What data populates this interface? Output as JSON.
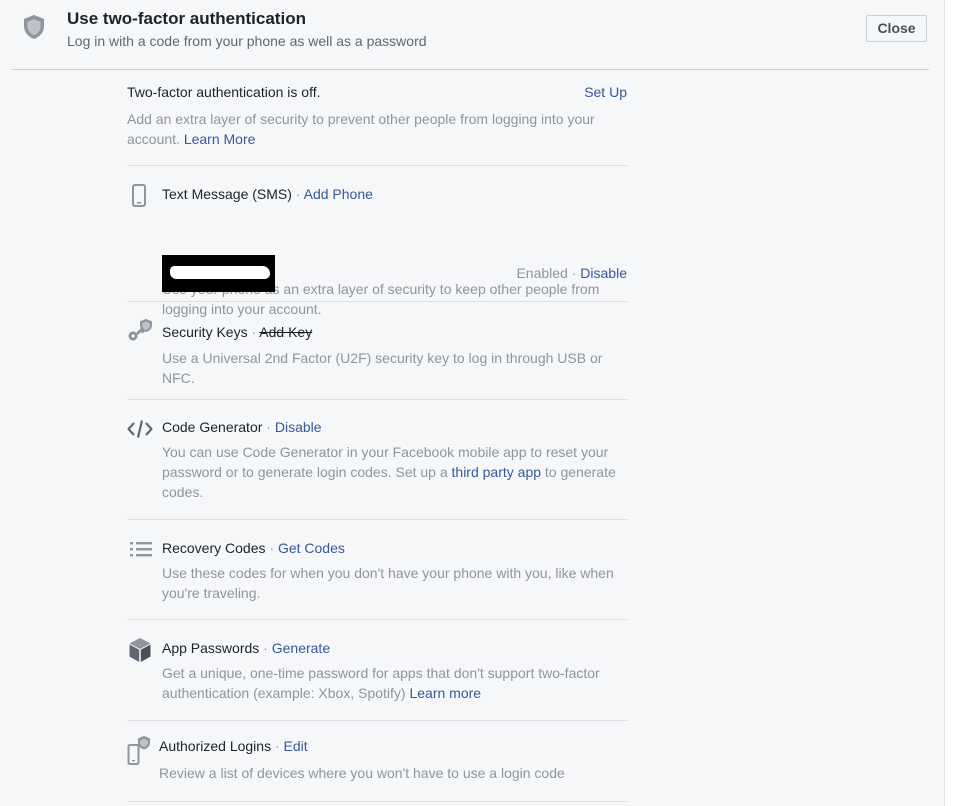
{
  "header": {
    "title": "Use two-factor authentication",
    "subtitle": "Log in with a code from your phone as well as a password",
    "close_label": "Close"
  },
  "status": {
    "text": "Two-factor authentication is off.",
    "setup_label": "Set Up",
    "desc": "Add an extra layer of security to prevent other people from logging into your account.",
    "learn_more": "Learn More"
  },
  "sms": {
    "title": "Text Message (SMS)",
    "sep": " · ",
    "action": "Add Phone",
    "desc": "Use your phone as an extra layer of security to keep other people from logging into your account.",
    "enabled": "Enabled",
    "disable": "Disable"
  },
  "keys": {
    "title": "Security Keys",
    "sep": " · ",
    "action": "Add Key",
    "desc": "Use a Universal 2nd Factor (U2F) security key to log in through USB or NFC."
  },
  "codegen": {
    "title": "Code Generator",
    "sep": " · ",
    "action": "Disable",
    "desc_a": "You can use Code Generator in your Facebook mobile app to reset your password or to generate login codes. Set up a ",
    "desc_link": "third party app",
    "desc_b": " to generate codes."
  },
  "recovery": {
    "title": "Recovery Codes",
    "sep": " · ",
    "action": "Get Codes",
    "desc": "Use these codes for when you don't have your phone with you, like when you're traveling."
  },
  "apppw": {
    "title": "App Passwords",
    "sep": " · ",
    "action": "Generate",
    "desc": "Get a unique, one-time password for apps that don't support two-factor authentication (example: Xbox, Spotify) ",
    "desc_link": "Learn more"
  },
  "authlogins": {
    "title": "Authorized Logins",
    "sep": " · ",
    "action": "Edit",
    "desc": "Review a list of devices where you won't have to use a login code"
  },
  "icons": {
    "header": "shield-icon",
    "sms": "phone-icon",
    "keys": "key-icon",
    "codegen": "code-icon",
    "recovery": "list-icon",
    "apppw": "cube-icon",
    "authlogins": "device-shield-icon"
  },
  "colors": {
    "link": "#365899",
    "muted": "#90949c",
    "text": "#1d2129",
    "panel_bg": "#f6f7f9"
  }
}
